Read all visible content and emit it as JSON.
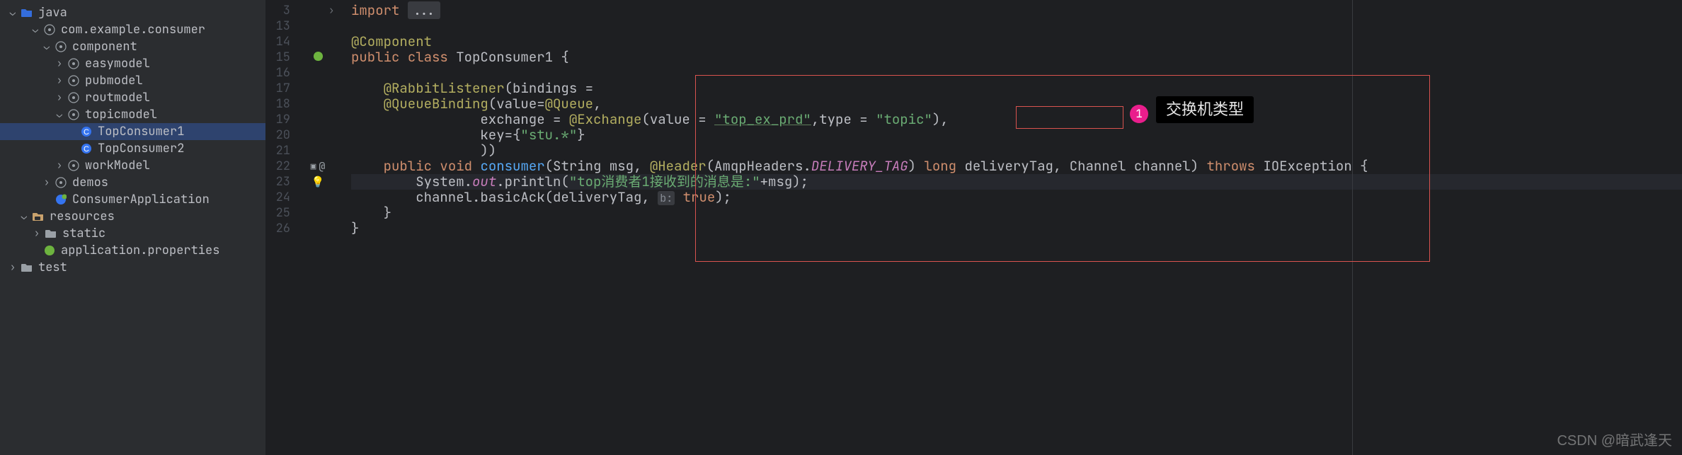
{
  "tree": {
    "java": "java",
    "pkg": "com.example.consumer",
    "component": "component",
    "easymodel": "easymodel",
    "pubmodel": "pubmodel",
    "routmodel": "routmodel",
    "topicmodel": "topicmodel",
    "topConsumer1": "TopConsumer1",
    "topConsumer2": "TopConsumer2",
    "workModel": "workModel",
    "demos": "demos",
    "consumerApp": "ConsumerApplication",
    "resources": "resources",
    "static": "static",
    "appProps": "application.properties",
    "test": "test"
  },
  "lineNumbers": [
    "3",
    "13",
    "14",
    "15",
    "16",
    "17",
    "18",
    "19",
    "20",
    "21",
    "22",
    "23",
    "24",
    "25",
    "26"
  ],
  "code": {
    "importKw": "import ",
    "importFold": "...",
    "compAnno": "@Component",
    "pubKw": "public ",
    "classKw": "class ",
    "className": "TopConsumer1 ",
    "openBrace": "{",
    "rabbitAnno": "@RabbitListener",
    "rabbitArgs": "(bindings =",
    "queueAnno": "@QueueBinding",
    "queueArgs1": "(value=",
    "queueAnnoInner": "@Queue",
    "comma1": ",",
    "exchKey": "exchange = ",
    "exchAnno": "@Exchange",
    "exchOpen": "(value = ",
    "exchVal": "\"top_ex_prd\"",
    "exchComma": ",",
    "typeKey": "type = ",
    "typeVal": "\"topic\"",
    "exchClose": "),",
    "keyKey": "key={",
    "keyVal": "\"stu.*\"",
    "keyClose": "}",
    "closePar": "))",
    "voidKw": "void ",
    "methodName": "consumer",
    "methodOpen": "(String msg, ",
    "headerAnno": "@Header",
    "headerOpen": "(AmqpHeaders.",
    "deliveryTag": "DELIVERY_TAG",
    "headerClose": ") ",
    "longKw": "long ",
    "dtParam": "deliveryTag, Channel channel) ",
    "throwsKw": "throws ",
    "ioex": "IOException {",
    "sysout1": "System.",
    "outField": "out",
    "println": ".println(",
    "printStr": "\"top消费者1接收到的消息是:\"",
    "plusMsg": "+msg);",
    "basicAck": "channel.basicAck(deliveryTag, ",
    "hintB": "b:",
    "trueVal": "true",
    "ackClose": ");",
    "closeBrace1": "}",
    "closeBrace2": "}"
  },
  "annotation": {
    "circleNum": "1",
    "label": "交换机类型"
  },
  "watermark": "CSDN @暗武逢天"
}
